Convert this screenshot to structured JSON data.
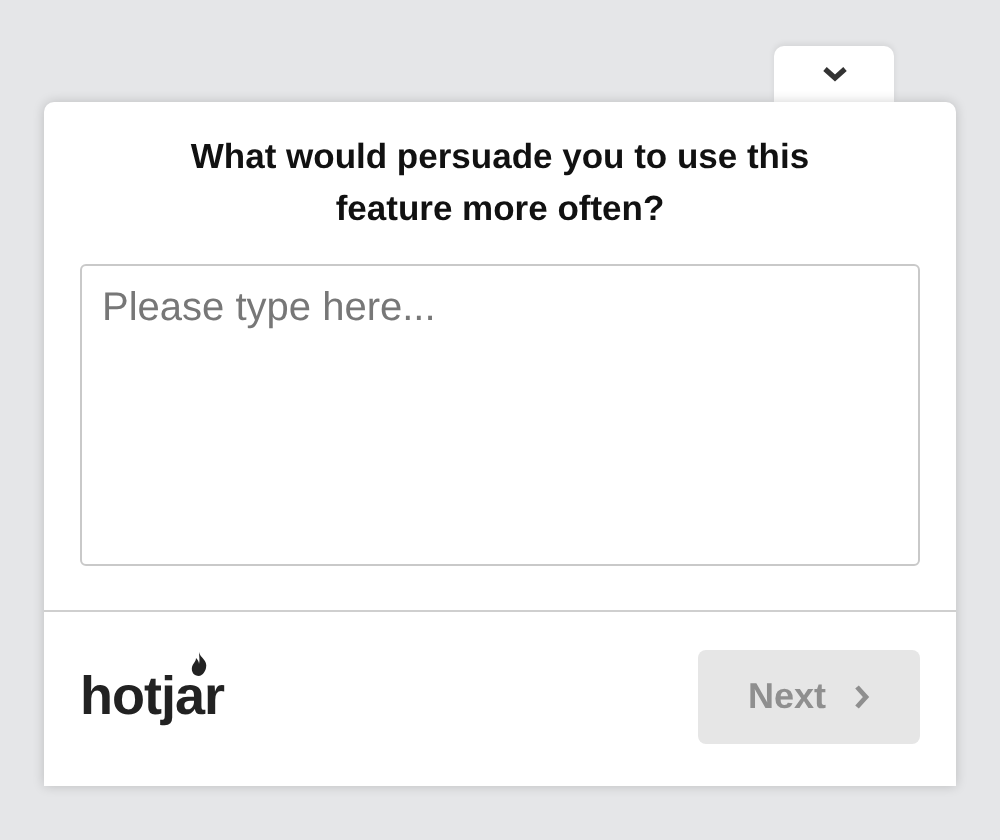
{
  "collapse_tab": {
    "expanded": true
  },
  "question": "What would persuade you to use this feature more often?",
  "answer": {
    "placeholder": "Please type here..."
  },
  "footer": {
    "logo": "hotjar",
    "next_button": {
      "label": "Next",
      "disabled": true
    }
  }
}
